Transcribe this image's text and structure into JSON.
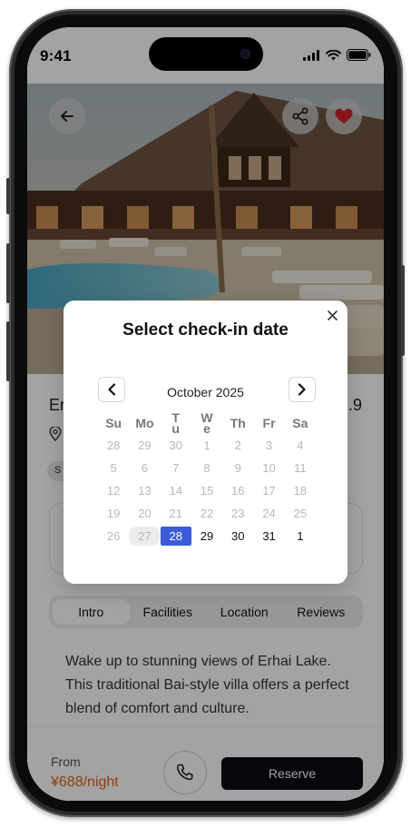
{
  "status_bar": {
    "time": "9:41"
  },
  "hero": {
    "back_icon": "arrow-left-icon",
    "share_icon": "share-icon",
    "favorite_icon": "heart-icon",
    "favorite_color": "#d3202e"
  },
  "listing": {
    "name_partial": "Er",
    "rating_partial": ".9",
    "tag_partial": "S",
    "intro_text": "Wake up to stunning views of Erhai Lake. This traditional Bai-style villa offers a perfect blend of comfort and culture."
  },
  "tabs": [
    {
      "label": "Intro",
      "active": true
    },
    {
      "label": "Facilities",
      "active": false
    },
    {
      "label": "Location",
      "active": false
    },
    {
      "label": "Reviews",
      "active": false
    }
  ],
  "bottom_bar": {
    "from_label": "From",
    "price": "¥688/night",
    "reserve_label": "Reserve"
  },
  "modal": {
    "title": "Select check-in date",
    "month": "October 2025",
    "weekdays": [
      "Su",
      "Mo",
      "Tu",
      "We",
      "Th",
      "Fr",
      "Sa"
    ],
    "weeks": [
      [
        "28",
        "29",
        "30",
        "1",
        "2",
        "3",
        "4"
      ],
      [
        "5",
        "6",
        "7",
        "8",
        "9",
        "10",
        "11"
      ],
      [
        "12",
        "13",
        "14",
        "15",
        "16",
        "17",
        "18"
      ],
      [
        "19",
        "20",
        "21",
        "22",
        "23",
        "24",
        "25"
      ],
      [
        "26",
        "27",
        "28",
        "29",
        "30",
        "31",
        "1"
      ]
    ],
    "today": "27",
    "selected": "28",
    "accent_color": "#3b5bdb"
  }
}
